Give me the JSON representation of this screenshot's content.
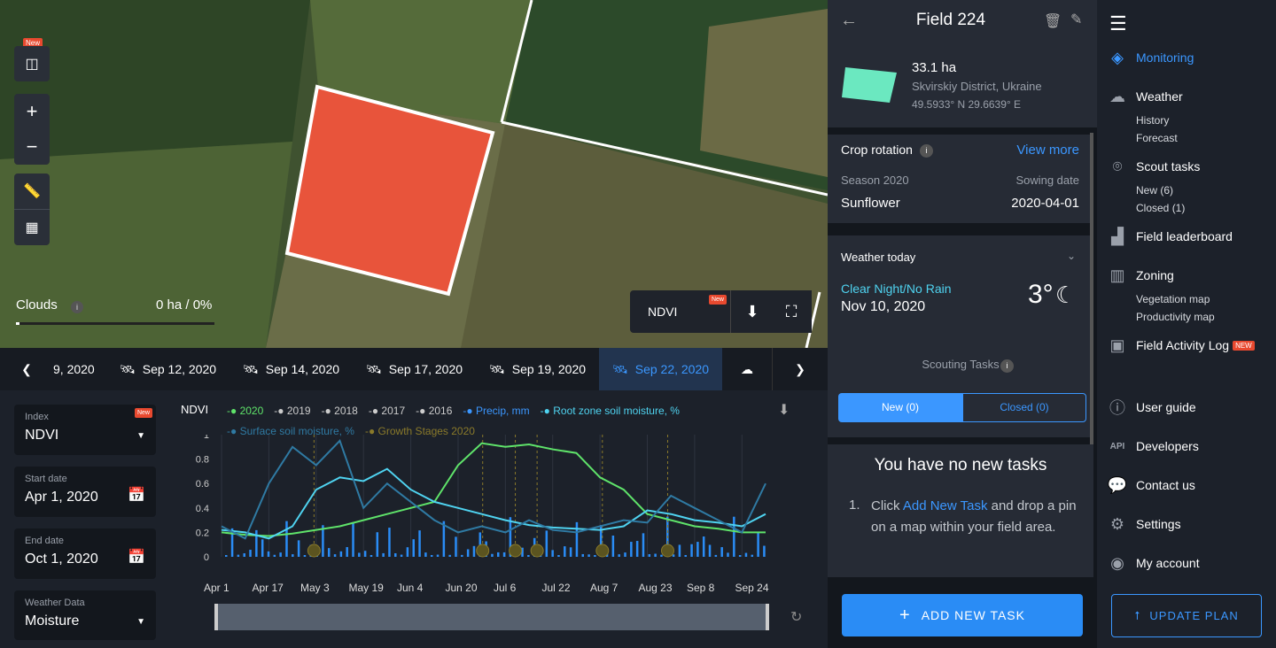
{
  "map": {
    "new_badge": "New",
    "clouds_label": "Clouds",
    "clouds_value": "0 ha / 0%",
    "layer_label": "NDVI",
    "layer_badge": "New",
    "zoom_in": "+",
    "zoom_out": "−"
  },
  "dates": [
    "9, 2020",
    "Sep 12, 2020",
    "Sep 14, 2020",
    "Sep 17, 2020",
    "Sep 19, 2020",
    "Sep 22, 2020"
  ],
  "inputs": {
    "index_label": "Index",
    "index_value": "NDVI",
    "index_badge": "New",
    "start_label": "Start date",
    "start_value": "Apr 1, 2020",
    "end_label": "End date",
    "end_value": "Oct 1, 2020",
    "weather_label": "Weather Data",
    "weather_value": "Moisture"
  },
  "chart_data": {
    "type": "line",
    "title": "NDVI",
    "legend": [
      "2020",
      "2019",
      "2018",
      "2017",
      "2016",
      "Precip, mm",
      "Root zone soil moisture, %",
      "Surface soil moisture, %",
      "Growth Stages 2020"
    ],
    "y_ticks": [
      "1",
      "0.8",
      "0.6",
      "0.4",
      "0.2",
      "0"
    ],
    "x_ticks": [
      "Apr 1",
      "Apr 17",
      "May 3",
      "May 19",
      "Jun 4",
      "Jun 20",
      "Jul 6",
      "Jul 22",
      "Aug 7",
      "Aug 23",
      "Sep 8",
      "Sep 24"
    ],
    "ylim": [
      0,
      1
    ],
    "series": [
      {
        "name": "2020",
        "color": "#5fe36a",
        "values": [
          0.2,
          0.18,
          0.17,
          0.19,
          0.22,
          0.25,
          0.3,
          0.35,
          0.4,
          0.45,
          0.75,
          0.93,
          0.9,
          0.92,
          0.88,
          0.85,
          0.65,
          0.55,
          0.35,
          0.3,
          0.25,
          0.23,
          0.2,
          0.2
        ]
      },
      {
        "name": "Root zone soil moisture, %",
        "color": "#4fd3f0",
        "values": [
          0.22,
          0.2,
          0.15,
          0.25,
          0.55,
          0.65,
          0.62,
          0.72,
          0.55,
          0.45,
          0.4,
          0.35,
          0.3,
          0.26,
          0.24,
          0.23,
          0.22,
          0.25,
          0.38,
          0.35,
          0.3,
          0.28,
          0.25,
          0.35
        ]
      },
      {
        "name": "Surface soil moisture, %",
        "color": "#2f7aa3",
        "values": [
          0.25,
          0.15,
          0.6,
          0.9,
          0.75,
          0.95,
          0.4,
          0.6,
          0.45,
          0.3,
          0.2,
          0.25,
          0.2,
          0.3,
          0.22,
          0.2,
          0.25,
          0.3,
          0.28,
          0.5,
          0.4,
          0.3,
          0.2,
          0.6
        ]
      }
    ],
    "growth_stages": [
      0.17,
      0.48,
      0.54,
      0.58,
      0.7,
      0.82
    ]
  },
  "field": {
    "title": "Field 224",
    "area": "33.1 ha",
    "location": "Skvirskiy District, Ukraine",
    "coords": "49.5933° N 29.6639° E",
    "crop_rotation": "Crop rotation",
    "view_more": "View more",
    "season_label": "Season 2020",
    "season_value": "Sunflower",
    "sowing_label": "Sowing date",
    "sowing_value": "2020-04-01",
    "weather_title": "Weather today",
    "weather_cond": "Clear Night/No Rain",
    "weather_date": "Nov 10, 2020",
    "weather_temp": "3°",
    "scouting_title": "Scouting Tasks",
    "tab_new": "New (0)",
    "tab_closed": "Closed (0)",
    "no_tasks": "You have no new tasks",
    "step1_a": "Click ",
    "step1_link": "Add New Task",
    "step1_b": " and drop a pin on a map within your field area.",
    "add_task": "ADD NEW TASK"
  },
  "sidebar": {
    "monitoring": "Monitoring",
    "weather": "Weather",
    "history": "History",
    "forecast": "Forecast",
    "scout": "Scout tasks",
    "scout_new": "New (6)",
    "scout_closed": "Closed (1)",
    "leaderboard": "Field leaderboard",
    "zoning": "Zoning",
    "veg_map": "Vegetation map",
    "prod_map": "Productivity map",
    "activity": "Field Activity Log",
    "activity_badge": "NEW",
    "guide": "User guide",
    "developers": "Developers",
    "api": "API",
    "contact": "Contact us",
    "settings": "Settings",
    "account": "My account",
    "update": "UPDATE PLAN"
  }
}
